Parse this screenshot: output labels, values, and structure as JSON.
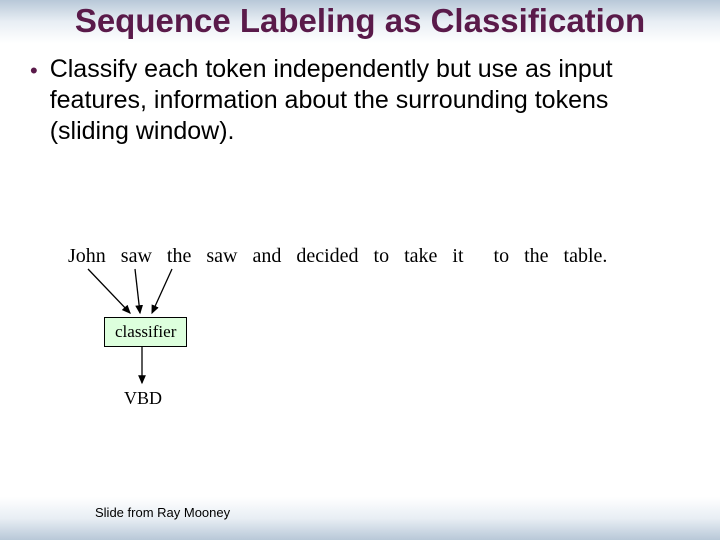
{
  "title": "Sequence Labeling as Classification",
  "bullet": "Classify each token independently but use as input features, information about the surrounding tokens (sliding window).",
  "tokens": [
    "John",
    "saw",
    "the",
    "saw",
    "and",
    "decided",
    "to",
    "take",
    "it",
    "to",
    "the",
    "table."
  ],
  "classifier_label": "classifier",
  "output_label": "VBD",
  "credit": "Slide from Ray Mooney"
}
